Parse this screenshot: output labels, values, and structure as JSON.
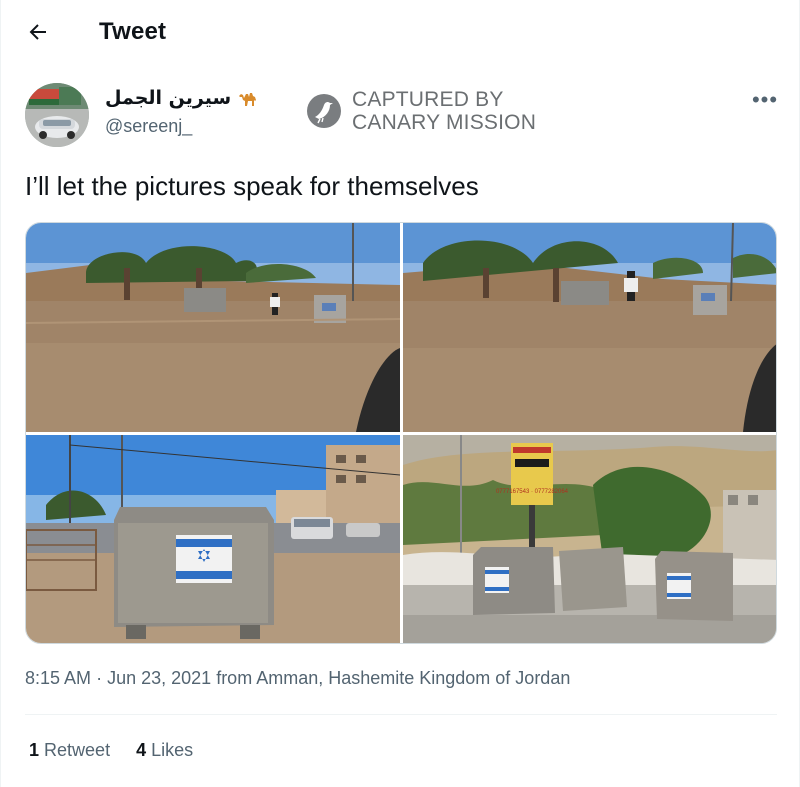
{
  "header": {
    "title": "Tweet",
    "back_icon": "arrow-left-icon"
  },
  "author": {
    "display_name": "سيرين الجمل",
    "emoji": "camel-emoji",
    "handle": "@sereenj_"
  },
  "watermark": {
    "line1": "CAPTURED BY",
    "line2": "CANARY MISSION",
    "icon": "canary-bird-icon"
  },
  "more_icon": "more-dots-icon",
  "tweet": {
    "text": "I’ll let the pictures speak for themselves",
    "media_alts": [
      "Image",
      "Image",
      "Image",
      "Image"
    ],
    "sign_text": "0777167543 · 0777282064",
    "time": "8:15 AM",
    "separator": "·",
    "date": "Jun 23, 2021",
    "location": "from Amman, Hashemite Kingdom of Jordan"
  },
  "stats": {
    "retweets_count": "1",
    "retweets_label": "Retweet",
    "likes_count": "4",
    "likes_label": "Likes"
  },
  "colors": {
    "text": "#0f1419",
    "secondary": "#536471",
    "border": "#cfd9de",
    "divider": "#eff3f4"
  }
}
